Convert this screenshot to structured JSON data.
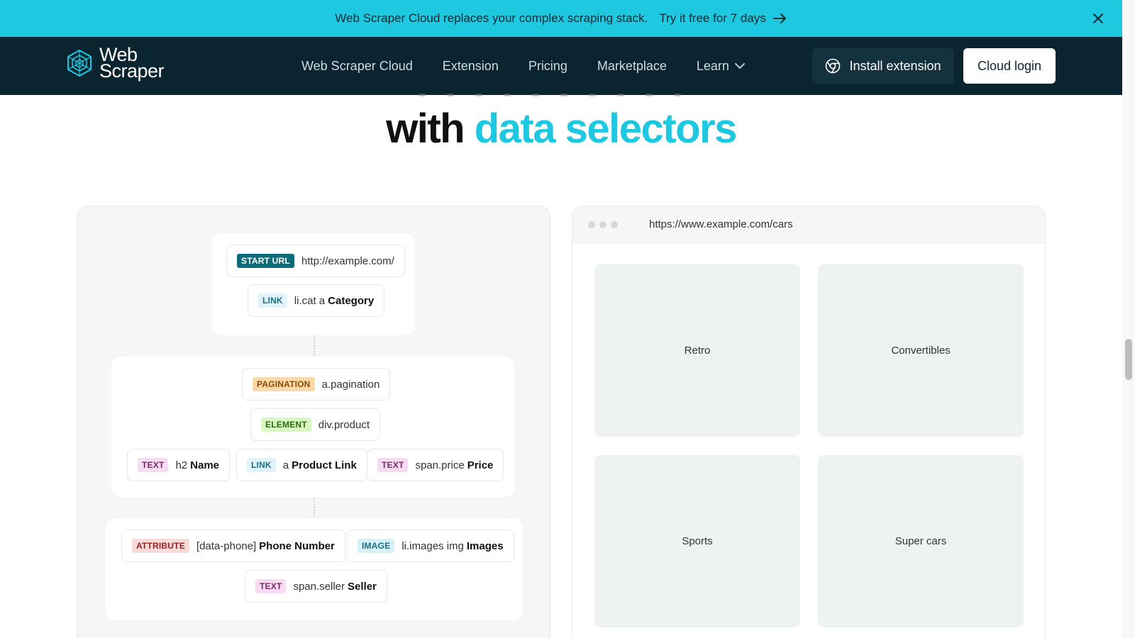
{
  "promo": {
    "message": "Web Scraper Cloud replaces your complex scraping stack.",
    "cta": "Try it free for 7 days"
  },
  "nav": {
    "logo_line1": "Web",
    "logo_line2": "Scraper",
    "items": [
      {
        "label": "Web Scraper Cloud"
      },
      {
        "label": "Extension"
      },
      {
        "label": "Pricing"
      },
      {
        "label": "Marketplace"
      },
      {
        "label": "Learn"
      }
    ],
    "install_label": "Install extension",
    "login_label": "Cloud login"
  },
  "headline": {
    "prefix": "with",
    "accent": "data selectors"
  },
  "sitemap": {
    "start_url": {
      "tag": "START URL",
      "value": "http://example.com/"
    },
    "category": {
      "tag": "LINK",
      "selector": "li.cat a",
      "name": "Category"
    },
    "pagination": {
      "tag": "PAGINATION",
      "selector": "a.pagination"
    },
    "element": {
      "tag": "ELEMENT",
      "selector": "div.product"
    },
    "name": {
      "tag": "TEXT",
      "selector": "h2",
      "name": "Name"
    },
    "product_link": {
      "tag": "LINK",
      "selector": "a",
      "name": "Product Link"
    },
    "price": {
      "tag": "TEXT",
      "selector": "span.price",
      "name": "Price"
    },
    "phone": {
      "tag": "ATTRIBUTE",
      "selector": "[data-phone]",
      "name": "Phone Number"
    },
    "images": {
      "tag": "IMAGE",
      "selector": "li.images img",
      "name": "Images"
    },
    "seller": {
      "tag": "TEXT",
      "selector": "span.seller",
      "name": "Seller"
    }
  },
  "browser": {
    "url": "https://www.example.com/cars",
    "tiles": [
      "Retro",
      "Convertibles",
      "Sports",
      "Super cars"
    ]
  },
  "colors": {
    "accent": "#1ec8e0",
    "nav_bg": "#0b2530",
    "tag_start_url": "#0f6b78",
    "tag_link": "#dff3f8",
    "tag_pagination": "#fbd9a8",
    "tag_element": "#d9f7c2",
    "tag_text": "#f5dcf0",
    "tag_attribute": "#fbdada",
    "tag_image": "#d6f1f7"
  }
}
